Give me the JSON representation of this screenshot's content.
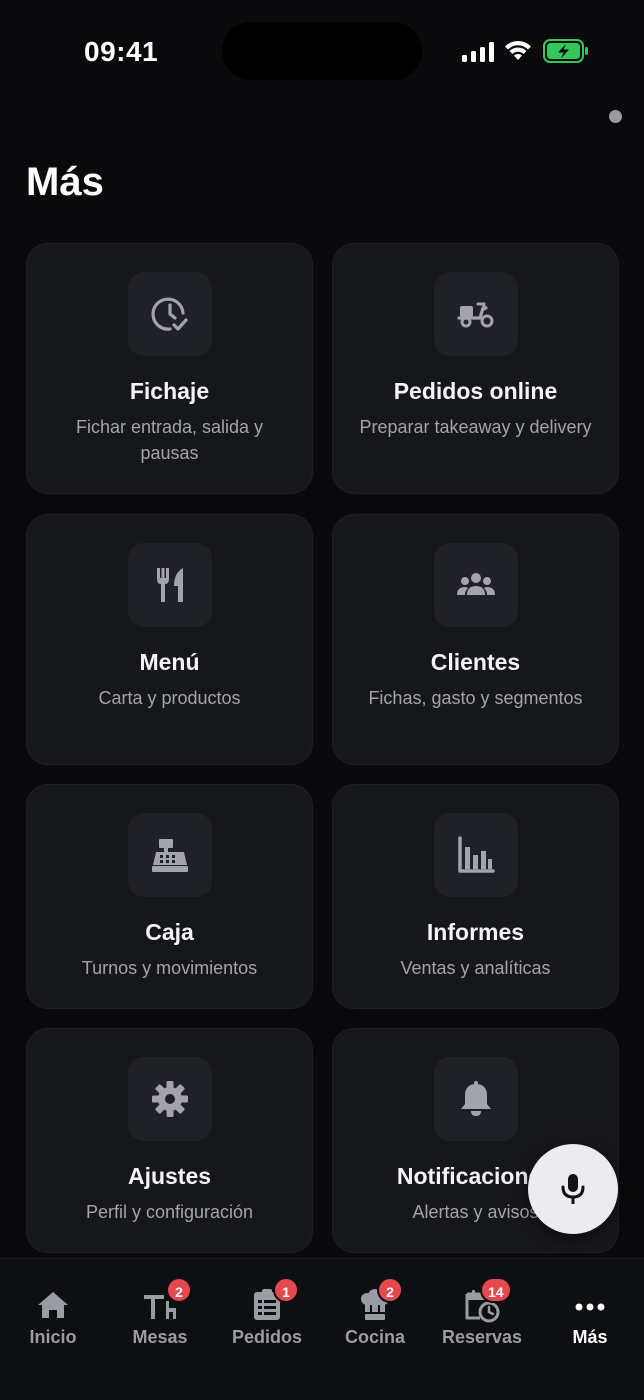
{
  "status_bar": {
    "time": "09:41"
  },
  "page": {
    "title": "Más"
  },
  "cards": [
    {
      "title": "Fichaje",
      "subtitle": "Fichar entrada, salida y pausas",
      "icon": "clock-check-icon"
    },
    {
      "title": "Pedidos online",
      "subtitle": "Preparar takeaway y delivery",
      "icon": "scooter-icon"
    },
    {
      "title": "Menú",
      "subtitle": "Carta y productos",
      "icon": "utensils-icon"
    },
    {
      "title": "Clientes",
      "subtitle": "Fichas, gasto y segmentos",
      "icon": "users-icon"
    },
    {
      "title": "Caja",
      "subtitle": "Turnos y movimientos",
      "icon": "cash-register-icon"
    },
    {
      "title": "Informes",
      "subtitle": "Ventas y analíticas",
      "icon": "bar-chart-icon"
    },
    {
      "title": "Ajustes",
      "subtitle": "Perfil y configuración",
      "icon": "gear-icon"
    },
    {
      "title": "Notificaciones",
      "subtitle": "Alertas y avisos",
      "icon": "bell-icon"
    }
  ],
  "tabs": [
    {
      "label": "Inicio",
      "icon": "home-icon",
      "badge": null,
      "active": false
    },
    {
      "label": "Mesas",
      "icon": "table-icon",
      "badge": "2",
      "active": false
    },
    {
      "label": "Pedidos",
      "icon": "order-list-icon",
      "badge": "1",
      "active": false
    },
    {
      "label": "Cocina",
      "icon": "chef-hat-icon",
      "badge": "2",
      "active": false
    },
    {
      "label": "Reservas",
      "icon": "calendar-clock-icon",
      "badge": "14",
      "active": false
    },
    {
      "label": "Más",
      "icon": "more-dots-icon",
      "badge": null,
      "active": true
    }
  ],
  "colors": {
    "background": "#0a0a0c",
    "card": "#16171b",
    "badge": "#e5484d",
    "battery": "#34c759",
    "fab": "#ececef"
  }
}
